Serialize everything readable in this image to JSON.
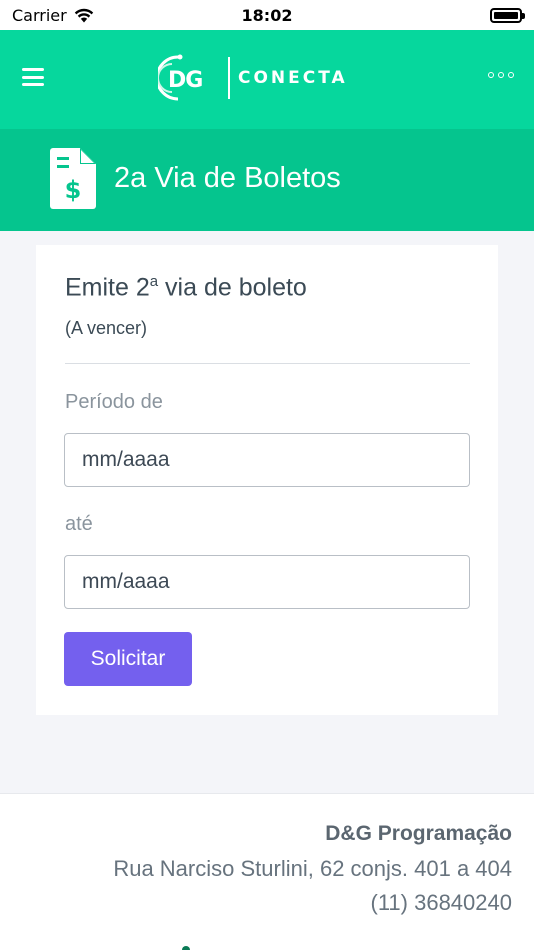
{
  "status_bar": {
    "carrier": "Carrier",
    "time": "18:02",
    "battery_level": 1.0
  },
  "app_bar": {
    "logo_mark": "DG",
    "logo_text": "CONECTA",
    "menu_icon": "hamburger-icon",
    "more_icon": "more-dots-icon",
    "background_color": "#06d79d"
  },
  "page_header": {
    "title": "2a Via de Boletos",
    "icon": "invoice-dollar-icon",
    "background_color": "#05c58e"
  },
  "form": {
    "title_main": "Emite 2",
    "title_sup": "a",
    "title_rest": " via de boleto",
    "subtitle": "(A vencer)",
    "from_label": "Período de",
    "from_placeholder": "mm/aaaa",
    "to_label": "até",
    "to_placeholder": "mm/aaaa",
    "submit_label": "Solicitar",
    "submit_color": "#7460ee"
  },
  "footer": {
    "company": "D&G Programação",
    "address": "Rua Narciso Sturlini, 62 conjs. 401 a 404",
    "phone": "(11) 36840240"
  }
}
